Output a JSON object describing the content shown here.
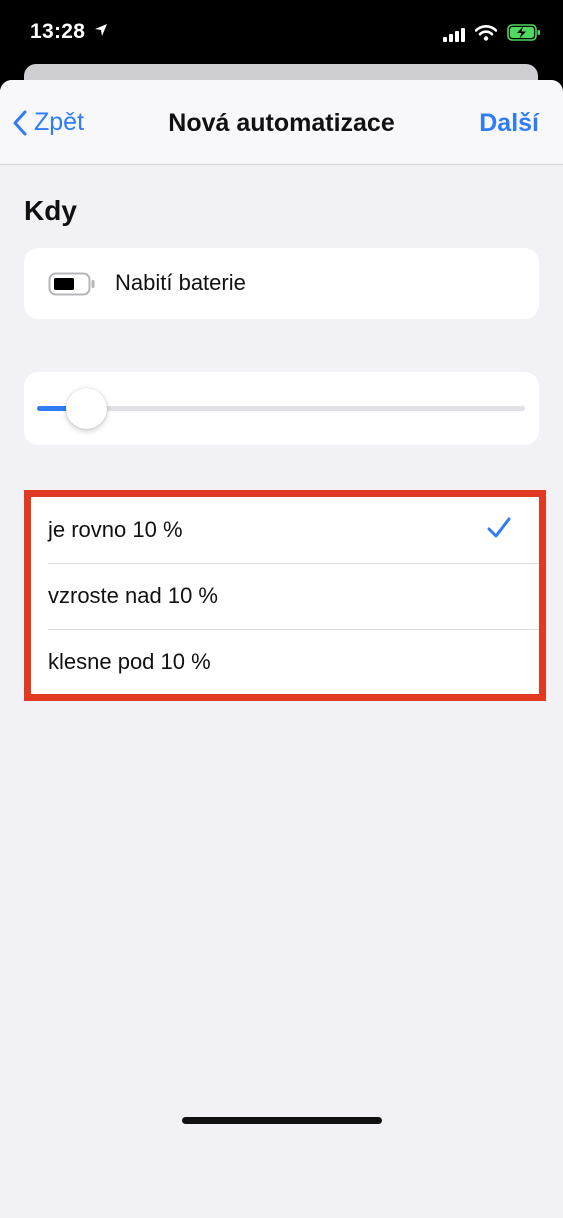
{
  "status_bar": {
    "time": "13:28",
    "icons": [
      "location-arrow-icon",
      "cellular-signal-icon",
      "wifi-icon",
      "battery-charging-icon"
    ]
  },
  "navbar": {
    "back_label": "Zpět",
    "title": "Nová automatizace",
    "next_label": "Další"
  },
  "section": {
    "title": "Kdy"
  },
  "trigger": {
    "icon": "battery-icon",
    "label": "Nabití baterie"
  },
  "slider": {
    "value_percent": 10
  },
  "options": [
    {
      "label": "je rovno 10 %",
      "selected": true
    },
    {
      "label": "vzroste nad 10 %",
      "selected": false
    },
    {
      "label": "klesne pod 10 %",
      "selected": false
    }
  ],
  "colors": {
    "accent": "#2f7cf6",
    "highlight_outline": "#e03a23",
    "sheet_background": "#f1f1f6"
  }
}
